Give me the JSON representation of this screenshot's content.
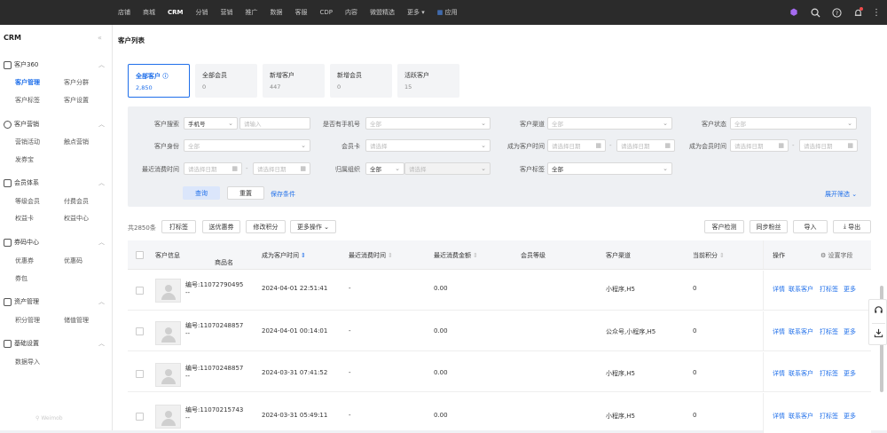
{
  "topnav": [
    "店铺",
    "商城",
    "CRM",
    "分销",
    "营销",
    "推广",
    "数据",
    "客服",
    "CDP",
    "内容",
    "微盟精选",
    "更多"
  ],
  "apps_label": "应用",
  "sidebar": {
    "title": "CRM",
    "groups": [
      {
        "label": "客户360",
        "items": [
          "客户管理",
          "客户分群",
          "客户标签",
          "客户设置"
        ]
      },
      {
        "label": "客户营销",
        "items": [
          "营销活动",
          "触点营销",
          "发券宝"
        ]
      },
      {
        "label": "会员体系",
        "items": [
          "等级会员",
          "付费会员",
          "权益卡",
          "权益中心"
        ]
      },
      {
        "label": "券码中心",
        "items": [
          "优惠券",
          "优惠码",
          "券包"
        ]
      },
      {
        "label": "资产管理",
        "items": [
          "积分管理",
          "储值管理"
        ]
      },
      {
        "label": "基础设置",
        "items": [
          "数据导入"
        ]
      }
    ],
    "brand": "Weimob"
  },
  "page_title": "客户列表",
  "stats": [
    {
      "label": "全部客户",
      "value": "2,850"
    },
    {
      "label": "全部会员",
      "value": "0"
    },
    {
      "label": "新增客户",
      "value": "447"
    },
    {
      "label": "新增会员",
      "value": "0"
    },
    {
      "label": "活跃客户",
      "value": "15"
    }
  ],
  "filters": {
    "search_label": "客户搜索",
    "search_type": "手机号",
    "search_ph": "请输入",
    "has_phone_label": "是否有手机号",
    "has_phone_val": "全部",
    "channel_label": "客户渠道",
    "channel_val": "全部",
    "status_label": "客户状态",
    "status_val": "全部",
    "identity_label": "客户身份",
    "identity_val": "全部",
    "card_label": "会员卡",
    "card_ph": "请选择",
    "become_customer_label": "成为客户时间",
    "become_member_label": "成为会员时间",
    "last_consume_label": "最近消费时间",
    "org_label": "归属组织",
    "org_val": "全部",
    "org_ph": "请选择",
    "tag_label": "客户标签",
    "tag_val": "全部",
    "date_ph": "请选择日期",
    "dash": "-",
    "query_btn": "查询",
    "reset_btn": "重置",
    "save_link": "保存条件",
    "expand_link": "展开筛选"
  },
  "toolbar": {
    "total": "共2850条",
    "buttons": [
      "打标签",
      "送优惠券",
      "修改积分",
      "更多操作"
    ],
    "right_buttons": [
      "客户检测",
      "同步粉丝",
      "导入",
      "导出"
    ]
  },
  "table": {
    "headers": [
      "客户信息",
      "商品名",
      "成为客户时间",
      "最近消费时间",
      "最近消费金额",
      "会员等级",
      "客户渠道",
      "当前积分",
      "操作",
      "设置字段"
    ],
    "ops": [
      "详情",
      "联系客户",
      "打标签",
      "更多"
    ],
    "rows": [
      {
        "id": "编号:11072790495",
        "name": "--",
        "time": "2024-04-01 22:51:41",
        "last": "-",
        "amount": "0.00",
        "level": "",
        "channel": "小程序,H5",
        "points": "0"
      },
      {
        "id": "编号:11070248857",
        "name": "--",
        "time": "2024-04-01 00:14:01",
        "last": "-",
        "amount": "0.00",
        "level": "",
        "channel": "公众号,小程序,H5",
        "points": "0"
      },
      {
        "id": "编号:11070248857",
        "name": "--",
        "time": "2024-03-31 07:41:52",
        "last": "-",
        "amount": "0.00",
        "level": "",
        "channel": "小程序,H5",
        "points": "0"
      },
      {
        "id": "编号:11070215743",
        "name": "--",
        "time": "2024-03-31 05:49:11",
        "last": "-",
        "amount": "0.00",
        "level": "",
        "channel": "小程序,H5",
        "points": "0"
      }
    ]
  }
}
